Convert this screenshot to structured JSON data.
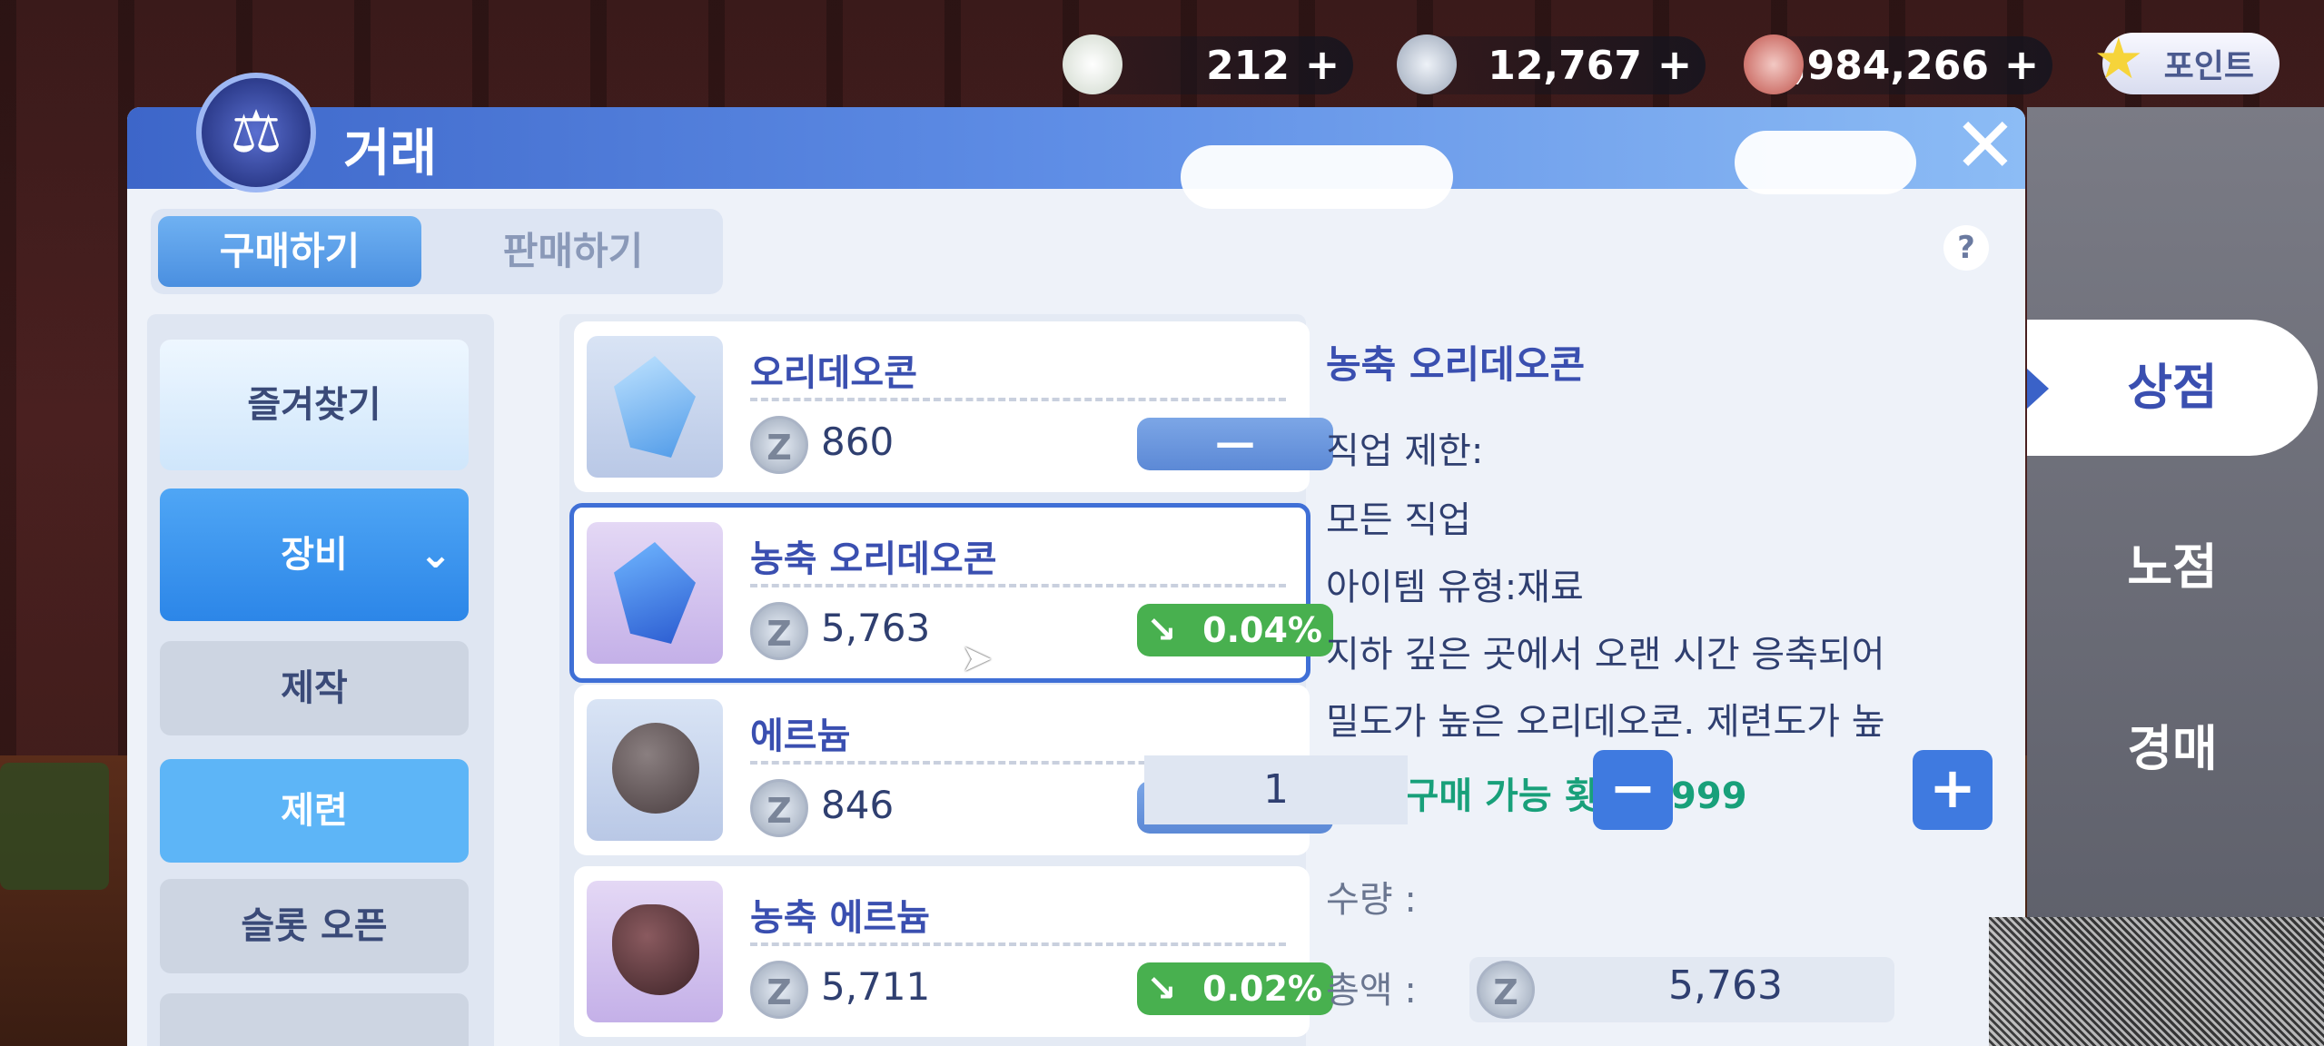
{
  "currencies": [
    {
      "value": "212",
      "icon": "spirit-icon"
    },
    {
      "value": "12,767",
      "icon": "zeny-coin-icon"
    },
    {
      "value": "2,984,266",
      "icon": "swirl-coin-icon"
    }
  ],
  "point_button": "포인트",
  "window_title": "거래",
  "tabs": {
    "buy": "구매하기",
    "sell": "판매하기"
  },
  "help": "?",
  "categories": {
    "favorites": "즐겨찾기",
    "equipment": "장비",
    "crafting": "제작",
    "refine": "제련",
    "slot_open": "슬롯 오픈"
  },
  "items": [
    {
      "name": "오리데오콘",
      "price": "860",
      "change": "—"
    },
    {
      "name": "농축 오리데오콘",
      "price": "5,763",
      "change": "0.04%"
    },
    {
      "name": "에르늄",
      "price": "846",
      "change": "—"
    },
    {
      "name": "농축 에르늄",
      "price": "5,711",
      "change": "0.02%"
    }
  ],
  "detail": {
    "name": "농축 오리데오콘",
    "job_label": "직업 제한:",
    "job_value": "모든 직업",
    "type": "아이템 유형:재료",
    "desc1": "지하 깊은 곳에서 오랜 시간 응축되어",
    "desc2": "밀도가 높은 오리데오콘. 제련도가 높",
    "limit": "오늘 구매 가능 횟수 : 999",
    "qty_label": "수량 :",
    "qty": "1",
    "total_label": "총액 :",
    "total": "5,763"
  },
  "coin_glyph": "Z",
  "side_tabs": {
    "shop": "상점",
    "stall": "노점",
    "auction": "경매"
  },
  "colors": {
    "accent": "#3f7ae0",
    "price_down": "#48b04f",
    "limit": "#18a07a"
  }
}
